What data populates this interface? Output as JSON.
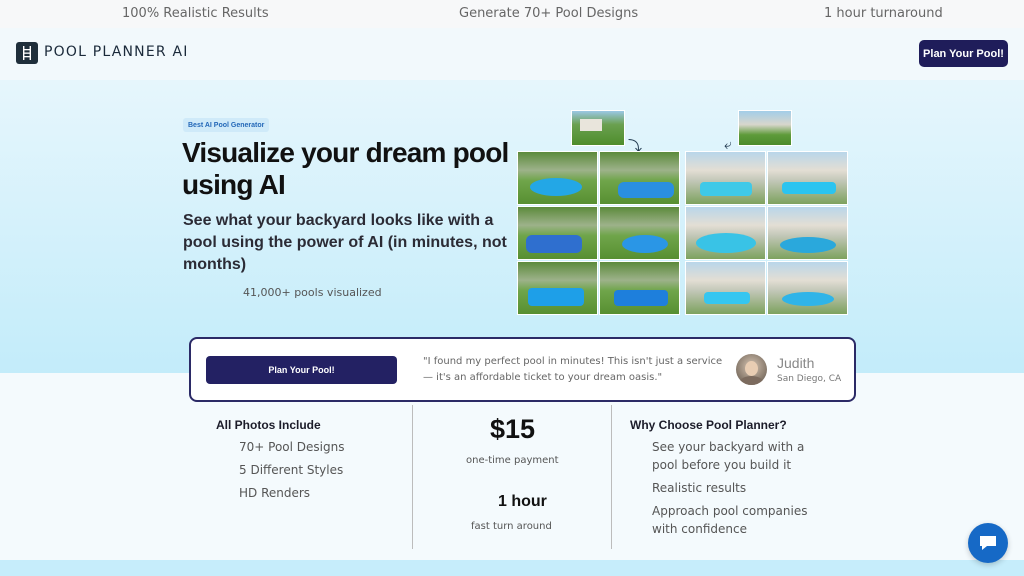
{
  "topbar": {
    "items": [
      "100% Realistic Results",
      "Generate 70+ Pool Designs",
      "1 hour turnaround"
    ]
  },
  "nav": {
    "brand": "POOL PLANNER AI",
    "cta": "Plan Your Pool!",
    "logo_icon": "ladder-icon"
  },
  "hero": {
    "badge": "Best AI Pool Generator",
    "title": "Visualize your dream pool using AI",
    "subtitle": "See what your backyard looks like with a pool using the power of AI (in minutes, not months)",
    "count": "41,000+ pools visualized"
  },
  "testimonial": {
    "cta": "Plan Your Pool!",
    "quote": "\"I found my perfect pool in minutes! This isn't just a service — it's an affordable ticket to your dream oasis.\"",
    "name": "Judith",
    "location": "San Diego, CA"
  },
  "features": {
    "left": {
      "title": "All Photos Include",
      "items": [
        "70+ Pool Designs",
        "5 Different Styles",
        "HD Renders"
      ]
    },
    "middle": {
      "price": "$15",
      "price_label": "one-time payment",
      "time": "1 hour",
      "time_label": "fast turn around"
    },
    "right": {
      "title": "Why Choose Pool Planner?",
      "items": [
        "See your backyard with a pool before you build it",
        "Realistic results",
        "Approach pool companies with confidence"
      ]
    }
  },
  "chat": {
    "icon": "chat-bubble-icon"
  },
  "colors": {
    "primary": "#232163",
    "chat": "#1669c6",
    "hero_bg": "#c3ecfa"
  }
}
